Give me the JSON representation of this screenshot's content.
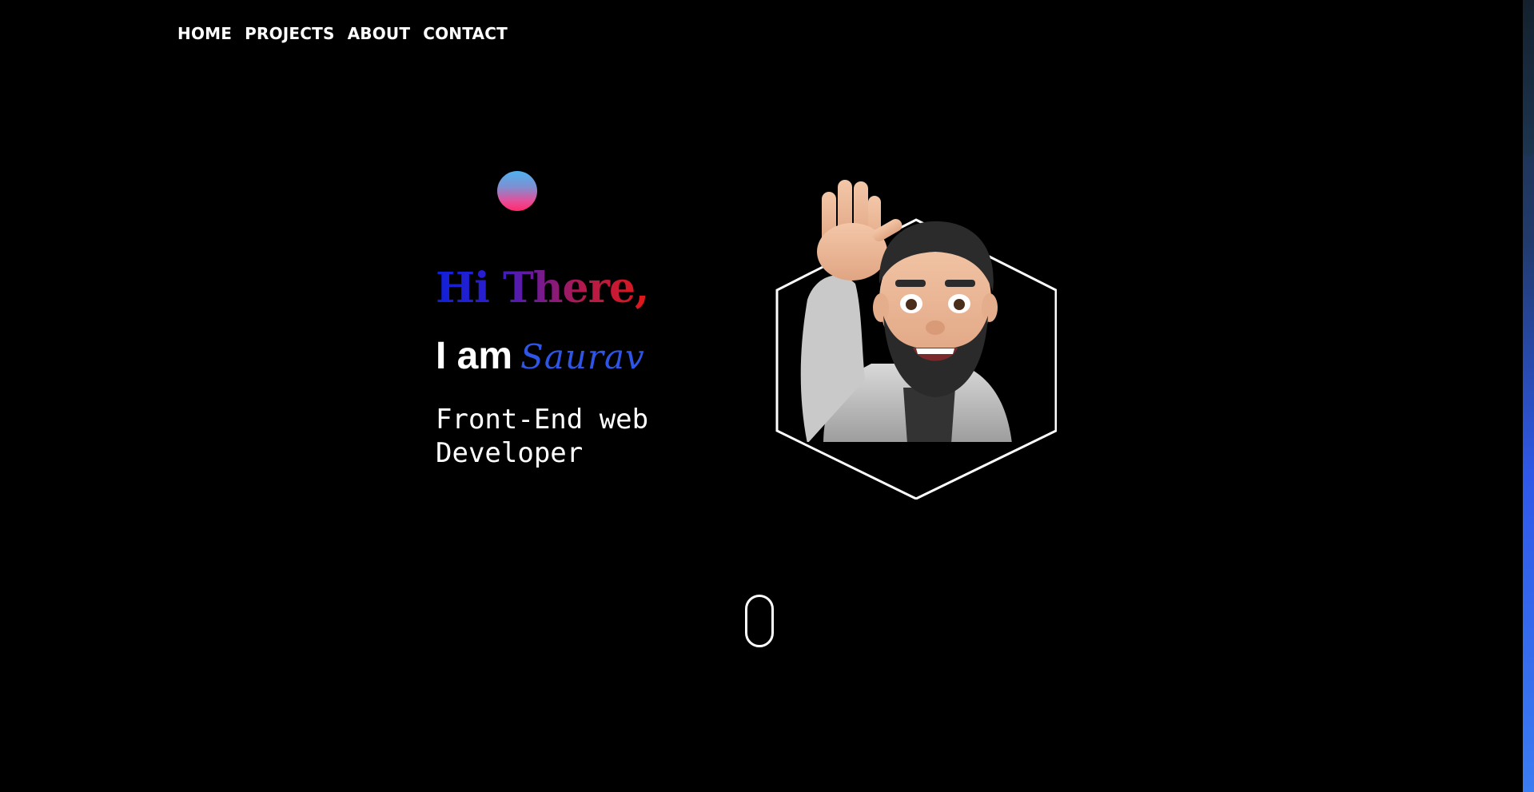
{
  "nav": {
    "items": [
      {
        "label": "HOME"
      },
      {
        "label": "PROJECTS"
      },
      {
        "label": "ABOUT"
      },
      {
        "label": "CONTACT"
      }
    ]
  },
  "hero": {
    "greeting": "Hi There,",
    "intro": "I am",
    "name": "Saurav",
    "role": "Front-End web Developer"
  },
  "colors": {
    "background": "#000000",
    "accent_name": "#2f55e8",
    "greeting_gradient_start": "#1020d8",
    "greeting_gradient_end": "#e01818",
    "orb_top": "#4fb2f0",
    "orb_bottom": "#ff2a6d"
  },
  "icons": {
    "avatar": "waving-memoji-avatar",
    "scroll": "mouse-scroll-icon"
  }
}
